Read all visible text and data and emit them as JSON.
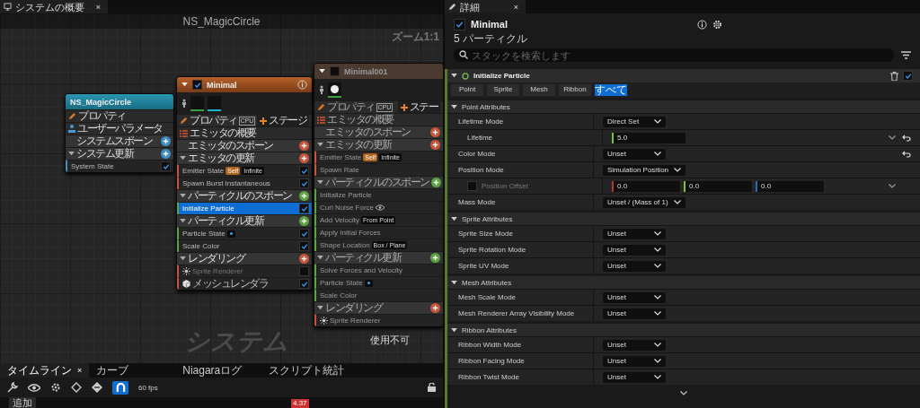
{
  "graph_tab": {
    "title": "システムの概要",
    "close": "×"
  },
  "graph": {
    "title": "NS_MagicCircle",
    "zoom": "ズーム1:1",
    "label": "システム",
    "note": "使用不可"
  },
  "nodes": [
    {
      "kind": "system",
      "title": "NS_MagicCircle",
      "rows": [
        {
          "kind": "properties",
          "label": "プロパティ"
        },
        {
          "kind": "parameters",
          "label": "ユーザーパラメータ"
        },
        {
          "kind": "stage",
          "label": "システムスポーン",
          "color": "#3d8fc2",
          "expanded": false,
          "modules": []
        },
        {
          "kind": "stage",
          "label": "システム更新",
          "color": "#3d8fc2",
          "expanded": true,
          "modules": [
            {
              "kind": "module",
              "label": "System State",
              "checked": true,
              "selected": false
            }
          ]
        }
      ]
    },
    {
      "kind": "emitter",
      "title": "Minimal",
      "enabled": true,
      "info": true,
      "thumbnails": [
        {
          "kind": "empty",
          "color": "#3aa13a"
        },
        {
          "kind": "empty",
          "color": "#19b5c8"
        }
      ],
      "rows": [
        {
          "kind": "properties",
          "label": "プロパティ",
          "badge": "CPU",
          "action": "ステージ"
        },
        {
          "kind": "summary",
          "label": "エミッタの概要"
        },
        {
          "kind": "stage",
          "label": "エミッタのスポーン",
          "color": "#c8553a",
          "expanded": false,
          "modules": []
        },
        {
          "kind": "stage",
          "label": "エミッタの更新",
          "color": "#c8553a",
          "expanded": true,
          "modules": [
            {
              "kind": "module",
              "label": "Emitter State",
              "tags": [
                {
                  "kind": "scope",
                  "text": "Self"
                },
                {
                  "kind": "value",
                  "text": "Infinite"
                }
              ],
              "checked": true,
              "selected": false
            },
            {
              "kind": "module",
              "label": "Spawn Burst Instantaneous",
              "checked": true,
              "selected": false
            }
          ]
        },
        {
          "kind": "stage",
          "label": "パーティクルのスポーン",
          "color": "#5aa540",
          "expanded": true,
          "modules": [
            {
              "kind": "module",
              "label": "Initialize Particle",
              "checked": true,
              "selected": true
            }
          ]
        },
        {
          "kind": "stage",
          "label": "パーティクル更新",
          "color": "#5aa540",
          "expanded": true,
          "modules": [
            {
              "kind": "module",
              "label": "Particle State",
              "dot_badge": true,
              "checked": true,
              "selected": false
            },
            {
              "kind": "module",
              "label": "Scale Color",
              "checked": true,
              "selected": false
            }
          ]
        },
        {
          "kind": "stage",
          "label": "レンダリング",
          "color": "#c8553a",
          "expanded": true,
          "modules": [
            {
              "kind": "sprite-renderer",
              "label": "Sprite Renderer",
              "disabled": true,
              "checked": false,
              "selected": false
            },
            {
              "kind": "mesh-renderer",
              "label": "メッシュレンダラ",
              "checked": true,
              "selected": false
            }
          ]
        }
      ]
    },
    {
      "kind": "emitter",
      "title": "Minimal001",
      "enabled": false,
      "info": false,
      "thumbnails": [
        {
          "kind": "dot",
          "color": "#3aa13a"
        }
      ],
      "rows": [
        {
          "kind": "properties",
          "label": "プロパティ",
          "badge": "CPU",
          "action": "ステー"
        },
        {
          "kind": "summary",
          "label": "エミッタの概要"
        },
        {
          "kind": "stage",
          "label": "エミッタのスポーン",
          "color": "#c8553a",
          "expanded": false,
          "modules": []
        },
        {
          "kind": "stage",
          "label": "エミッタの更新",
          "color": "#c8553a",
          "expanded": true,
          "modules": [
            {
              "kind": "module",
              "label": "Emitter State",
              "tags": [
                {
                  "kind": "scope",
                  "text": "Self"
                },
                {
                  "kind": "value",
                  "text": "Infinite"
                }
              ],
              "selected": false
            },
            {
              "kind": "module",
              "label": "Spawn Rate",
              "selected": false
            }
          ]
        },
        {
          "kind": "stage",
          "label": "パーティクルのスポーン",
          "color": "#5aa540",
          "expanded": true,
          "modules": [
            {
              "kind": "module",
              "label": "Initialize Particle",
              "selected": false
            },
            {
              "kind": "module",
              "label": "Curl Noise Force",
              "watched": true,
              "selected": false
            },
            {
              "kind": "module",
              "label": "Add Velocity",
              "tags": [
                {
                  "kind": "value",
                  "text": "From Point"
                }
              ],
              "selected": false
            },
            {
              "kind": "module",
              "label": "Apply Initial Forces",
              "selected": false
            },
            {
              "kind": "module",
              "label": "Shape Location",
              "tags": [
                {
                  "kind": "value",
                  "text": "Box / Plane"
                }
              ],
              "selected": false
            }
          ]
        },
        {
          "kind": "stage",
          "label": "パーティクル更新",
          "color": "#5aa540",
          "expanded": true,
          "modules": [
            {
              "kind": "module",
              "label": "Solve Forces and Velocity",
              "selected": false
            },
            {
              "kind": "module",
              "label": "Particle State",
              "dot_badge": true,
              "selected": false
            },
            {
              "kind": "module",
              "label": "Scale Color",
              "selected": false
            }
          ]
        },
        {
          "kind": "stage",
          "label": "レンダリング",
          "color": "#c8553a",
          "expanded": true,
          "modules": [
            {
              "kind": "sprite-renderer",
              "label": "Sprite Renderer",
              "selected": false
            }
          ]
        }
      ]
    }
  ],
  "bottom": {
    "tabs": [
      {
        "label": "タイムライン",
        "selected": true,
        "close": "×"
      },
      {
        "label": "カーブ",
        "selected": false
      },
      {
        "label": "Niagaraログ",
        "selected": false
      },
      {
        "label": "スクリプト統計",
        "selected": false
      }
    ],
    "snap_on": true,
    "fps": "60 fps",
    "add": "追加",
    "time": "4.37"
  },
  "details": {
    "tab": "詳細",
    "close": "×",
    "emitter": {
      "name": "Minimal",
      "enabled": true
    },
    "count": "5 パーティクル",
    "search": {
      "placeholder": "スタックを検索します"
    },
    "module": {
      "name": "Initialize Particle",
      "enabled": true
    },
    "filters": [
      {
        "label": "Point",
        "selected": false
      },
      {
        "label": "Sprite",
        "selected": false
      },
      {
        "label": "Mesh",
        "selected": false
      },
      {
        "label": "Ribbon",
        "selected": false
      },
      {
        "label": "すべて",
        "selected": true
      }
    ],
    "sections": [
      {
        "title": "Point Attributes",
        "rows": [
          {
            "kind": "dropdown",
            "label": "Lifetime Mode",
            "value": "Direct Set",
            "children": [
              {
                "kind": "number",
                "label": "Lifetime",
                "value": "5.0",
                "resettable": true
              }
            ]
          },
          {
            "kind": "dropdown",
            "label": "Color Mode",
            "value": "Unset",
            "resettable": true
          },
          {
            "kind": "dropdown",
            "label": "Position Mode",
            "value": "Simulation Position",
            "children": [
              {
                "kind": "vector",
                "label": "Position Offset",
                "checked": false,
                "values": [
                  "0.0",
                  "0.0",
                  "0.0"
                ]
              }
            ]
          },
          {
            "kind": "dropdown",
            "label": "Mass Mode",
            "value": "Unset / (Mass of 1)"
          }
        ]
      },
      {
        "title": "Sprite Attributes",
        "rows": [
          {
            "kind": "dropdown",
            "label": "Sprite Size Mode",
            "value": "Unset"
          },
          {
            "kind": "dropdown",
            "label": "Sprite Rotation Mode",
            "value": "Unset"
          },
          {
            "kind": "dropdown",
            "label": "Sprite UV Mode",
            "value": "Unset"
          }
        ]
      },
      {
        "title": "Mesh Attributes",
        "rows": [
          {
            "kind": "dropdown",
            "label": "Mesh Scale Mode",
            "value": "Unset"
          },
          {
            "kind": "dropdown",
            "label": "Mesh Renderer Array Visibility Mode",
            "value": "Unset"
          }
        ]
      },
      {
        "title": "Ribbon Attributes",
        "rows": [
          {
            "kind": "dropdown",
            "label": "Ribbon Width Mode",
            "value": "Unset"
          },
          {
            "kind": "dropdown",
            "label": "Ribbon Facing Mode",
            "value": "Unset"
          },
          {
            "kind": "dropdown",
            "label": "Ribbon Twist Mode",
            "value": "Unset"
          }
        ]
      }
    ]
  }
}
